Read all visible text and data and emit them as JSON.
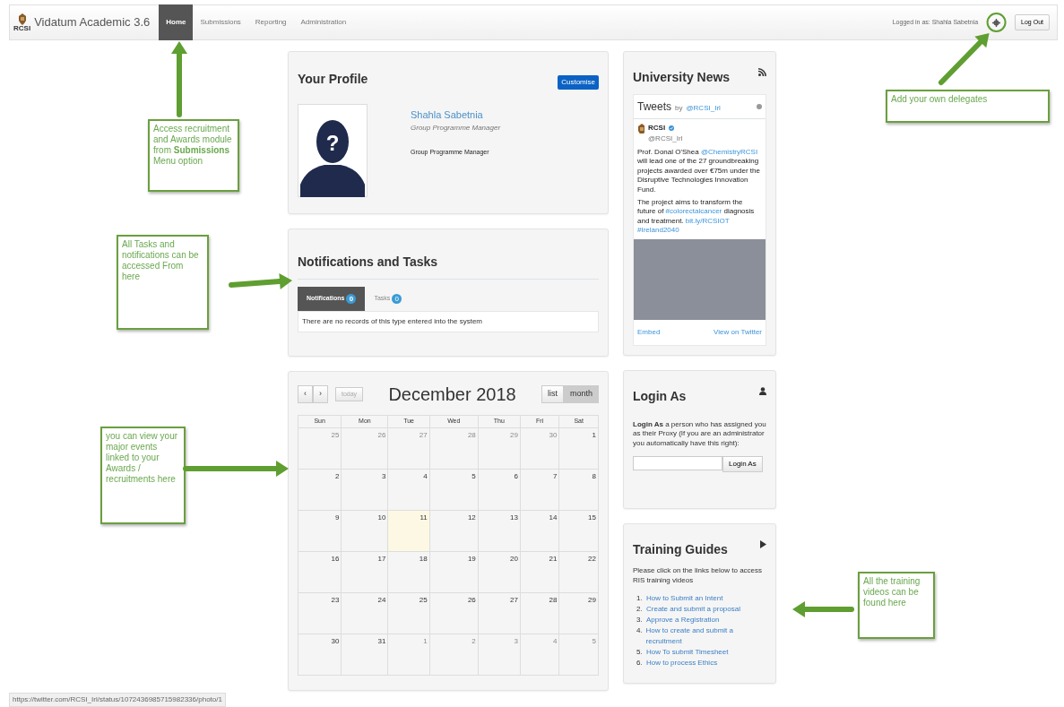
{
  "navbar": {
    "brand_mark": "RCSI",
    "brand": "Vidatum Academic 3.6",
    "items": [
      {
        "label": "Home",
        "selected": true
      },
      {
        "label": "Submissions",
        "selected": false
      },
      {
        "label": "Reporting",
        "selected": false
      },
      {
        "label": "Administration",
        "selected": false
      }
    ],
    "logged_in": "Logged in as: Shahla Sabetnia",
    "logout": "Log Out"
  },
  "profile": {
    "title": "Your Profile",
    "customise": "Customise",
    "avatar_mark": "?",
    "name": "Shahla Sabetnia",
    "subtitle": "Group Programme Manager",
    "role": "Group Programme Manager"
  },
  "notifications": {
    "title": "Notifications and Tasks",
    "tabs": [
      {
        "label": "Notifications",
        "count": "0",
        "selected": true
      },
      {
        "label": "Tasks",
        "count": "0",
        "selected": false
      }
    ],
    "empty": "There are no records of this type entered into the system"
  },
  "calendar": {
    "prev": "‹",
    "next": "›",
    "today": "today",
    "title": "December 2018",
    "views": [
      {
        "label": "list",
        "selected": false
      },
      {
        "label": "month",
        "selected": true
      }
    ],
    "weekdays": [
      "Sun",
      "Mon",
      "Tue",
      "Wed",
      "Thu",
      "Fri",
      "Sat"
    ],
    "weeks": [
      [
        {
          "day": "25",
          "other_month": true,
          "today": false
        },
        {
          "day": "26",
          "other_month": true,
          "today": false
        },
        {
          "day": "27",
          "other_month": true,
          "today": false
        },
        {
          "day": "28",
          "other_month": true,
          "today": false
        },
        {
          "day": "29",
          "other_month": true,
          "today": false
        },
        {
          "day": "30",
          "other_month": true,
          "today": false
        },
        {
          "day": "1",
          "other_month": false,
          "today": false
        }
      ],
      [
        {
          "day": "2",
          "other_month": false,
          "today": false
        },
        {
          "day": "3",
          "other_month": false,
          "today": false
        },
        {
          "day": "4",
          "other_month": false,
          "today": false
        },
        {
          "day": "5",
          "other_month": false,
          "today": false
        },
        {
          "day": "6",
          "other_month": false,
          "today": false
        },
        {
          "day": "7",
          "other_month": false,
          "today": false
        },
        {
          "day": "8",
          "other_month": false,
          "today": false
        }
      ],
      [
        {
          "day": "9",
          "other_month": false,
          "today": false
        },
        {
          "day": "10",
          "other_month": false,
          "today": false
        },
        {
          "day": "11",
          "other_month": false,
          "today": true
        },
        {
          "day": "12",
          "other_month": false,
          "today": false
        },
        {
          "day": "13",
          "other_month": false,
          "today": false
        },
        {
          "day": "14",
          "other_month": false,
          "today": false
        },
        {
          "day": "15",
          "other_month": false,
          "today": false
        }
      ],
      [
        {
          "day": "16",
          "other_month": false,
          "today": false
        },
        {
          "day": "17",
          "other_month": false,
          "today": false
        },
        {
          "day": "18",
          "other_month": false,
          "today": false
        },
        {
          "day": "19",
          "other_month": false,
          "today": false
        },
        {
          "day": "20",
          "other_month": false,
          "today": false
        },
        {
          "day": "21",
          "other_month": false,
          "today": false
        },
        {
          "day": "22",
          "other_month": false,
          "today": false
        }
      ],
      [
        {
          "day": "23",
          "other_month": false,
          "today": false
        },
        {
          "day": "24",
          "other_month": false,
          "today": false
        },
        {
          "day": "25",
          "other_month": false,
          "today": false
        },
        {
          "day": "26",
          "other_month": false,
          "today": false
        },
        {
          "day": "27",
          "other_month": false,
          "today": false
        },
        {
          "day": "28",
          "other_month": false,
          "today": false
        },
        {
          "day": "29",
          "other_month": false,
          "today": false
        }
      ],
      [
        {
          "day": "30",
          "other_month": false,
          "today": false
        },
        {
          "day": "31",
          "other_month": false,
          "today": false
        },
        {
          "day": "1",
          "other_month": true,
          "today": false
        },
        {
          "day": "2",
          "other_month": true,
          "today": false
        },
        {
          "day": "3",
          "other_month": true,
          "today": false
        },
        {
          "day": "4",
          "other_month": true,
          "today": false
        },
        {
          "day": "5",
          "other_month": true,
          "today": false
        }
      ]
    ]
  },
  "news": {
    "title": "University News",
    "tweets_title": "Tweets",
    "tweets_by": "by",
    "tweets_handle": "@RCSI_Irl",
    "tweet": {
      "author": "RCSI",
      "handle": "@RCSI_Irl",
      "paragraphs": [
        [
          {
            "kind": "plain",
            "text": "Prof. Donal O'Shea "
          },
          {
            "kind": "link",
            "text": "@ChemistryRCSI"
          },
          {
            "kind": "plain",
            "text": " will lead one of the 27 groundbreaking projects awarded over €75m under the Disruptive Technologies Innovation Fund."
          }
        ],
        [
          {
            "kind": "plain",
            "text": "The project aims to transform the future of "
          },
          {
            "kind": "link",
            "text": "#colorectalcancer"
          },
          {
            "kind": "plain",
            "text": " diagnosis and treatment. "
          },
          {
            "kind": "link",
            "text": "bit.ly/RCSIOT"
          },
          {
            "kind": "link",
            "text": "#Ireland2040"
          }
        ]
      ]
    },
    "embed": "Embed",
    "view": "View on Twitter"
  },
  "login_as": {
    "title": "Login As",
    "text": "**Login As** a person who has assigned you as their Proxy (If you are an administrator you automatically have this right):",
    "button": "Login As"
  },
  "training": {
    "title": "Training Guides",
    "intro": "Please click on the links below to access RIS training videos",
    "links": [
      {
        "number": "1.",
        "label": "How to Submit an Intent"
      },
      {
        "number": "2.",
        "label": "Create and submit a proposal"
      },
      {
        "number": "3.",
        "label": "Approve a Registration"
      },
      {
        "number": "4.",
        "label": "How to create and submit a recruitment"
      },
      {
        "number": "5.",
        "label": "How To submit Timesheet"
      },
      {
        "number": "6.",
        "label": "How to process Ethics"
      }
    ]
  },
  "status_url": "https://twitter.com/RCSI_Irl/status/1072436985715982336/photo/1",
  "annotations": [
    {
      "text": "Add your own delegates"
    },
    {
      "text": "Access recruitment and Awards module from **Submissions** Menu option"
    },
    {
      "text": "All Tasks and notifications can be accessed From here"
    },
    {
      "text": "you can view your major events linked to your Awards / recruitments here"
    },
    {
      "text": "All the training videos can be found here"
    }
  ]
}
